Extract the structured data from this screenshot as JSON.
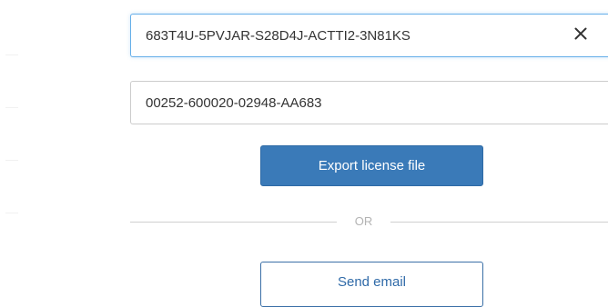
{
  "license_key_field": {
    "value": "683T4U-5PVJAR-S28D4J-ACTTI2-3N81KS",
    "clear_icon": "close-icon"
  },
  "serial_field": {
    "value": "00252-600020-02948-AA683"
  },
  "export_button": {
    "label": "Export license file"
  },
  "divider": {
    "text": "OR"
  },
  "email_button": {
    "label": "Send email"
  },
  "colors": {
    "primary": "#3a7ab8",
    "primary_text": "#ffffff",
    "secondary_text": "#2f6aa8",
    "field_focus_border": "#66afe9",
    "divider": "#cfcfcf"
  }
}
